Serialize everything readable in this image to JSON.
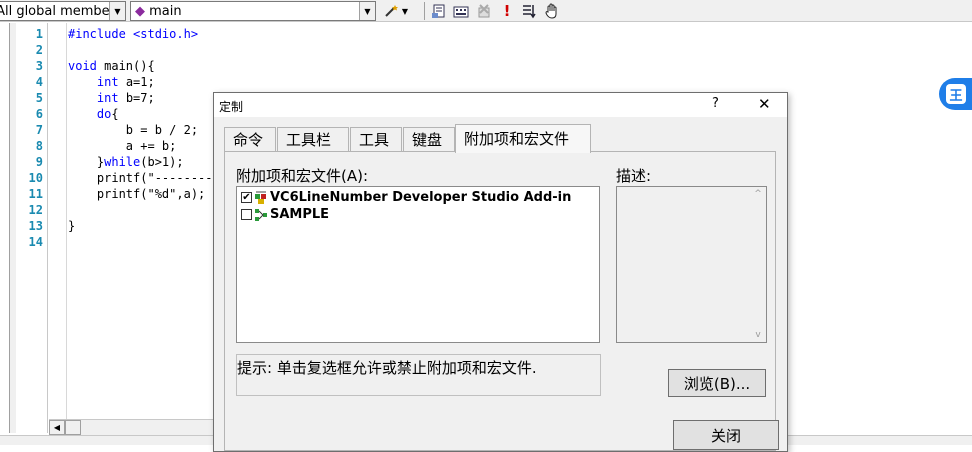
{
  "toolbar": {
    "class_combo": "(All global members",
    "func_combo": "main",
    "icons": [
      "wand-icon",
      "page-icon",
      "build-icon",
      "remove-breakpoints-icon",
      "exclamation-icon",
      "list-icon",
      "hand-icon"
    ]
  },
  "editor": {
    "line_numbers": [
      "1",
      "2",
      "3",
      "4",
      "5",
      "6",
      "7",
      "8",
      "9",
      "10",
      "11",
      "12",
      "13",
      "14"
    ],
    "lines": [
      "#include <stdio.h>",
      "",
      "void main(){",
      "    int a=1;",
      "    int b=7;",
      "    do{",
      "        b = b / 2;",
      "        a += b;",
      "    }while(b>1);",
      "    printf(\"--------",
      "    printf(\"%d\",a);",
      "",
      "}",
      ""
    ]
  },
  "dialog": {
    "title": "定制",
    "help": "?",
    "close": "✕",
    "tabs": [
      "命令",
      "工具栏",
      "工具",
      "键盘",
      "附加项和宏文件"
    ],
    "list_label": "附加项和宏文件(A):",
    "items": [
      {
        "label": "VC6LineNumber Developer Studio Add-in",
        "checked": "✔"
      },
      {
        "label": "SAMPLE",
        "checked": ""
      }
    ],
    "desc_label": "描述:",
    "hint": "提示: 单击复选框允许或禁止附加项和宏文件.",
    "browse_button": "浏览(B)...",
    "close_button": "关闭"
  },
  "floating_badge": "王",
  "colors": {
    "line_number": "#1a8ab0",
    "keyword": "#0000ff",
    "badge": "#1f7ee8"
  }
}
